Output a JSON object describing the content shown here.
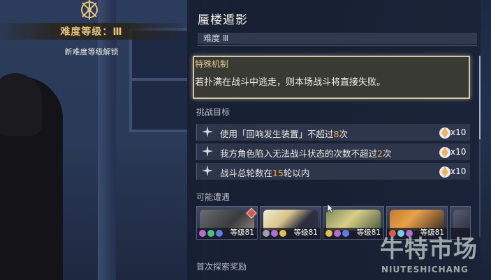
{
  "difficulty": {
    "title": "难度等级：Ⅲ",
    "subtitle": "新难度等级解锁"
  },
  "stage": {
    "title": "蜃楼遁影",
    "difficulty_label": "难度 Ⅲ"
  },
  "special_mechanic": {
    "heading": "特殊机制",
    "text": "若扑满在战斗中逃走，则本场战斗将直接失败。"
  },
  "challenge": {
    "heading": "挑战目标",
    "goals": [
      {
        "before": "使用「回响发生装置」不超过",
        "num": "8",
        "after": "次",
        "reward_qty": "x10"
      },
      {
        "before": "我方角色陷入无法战斗状态的次数不超过",
        "num": "2",
        "after": "次",
        "reward_qty": "x10"
      },
      {
        "before": "战斗总轮数在",
        "num": "15",
        "after": "轮以内",
        "reward_qty": "x10"
      }
    ]
  },
  "encounters": {
    "heading": "可能遭遇",
    "enemies": [
      {
        "level": "等级81"
      },
      {
        "level": "等级81"
      },
      {
        "level": "等级81"
      },
      {
        "level": "等级81"
      }
    ]
  },
  "first_explore": {
    "heading": "首次探索奖励"
  },
  "watermark": {
    "main": "牛特市场",
    "sub": "NIUTESHICHANG"
  },
  "colors": {
    "accent_gold": "#e7c27a",
    "highlight_orange": "#f0a845",
    "special_border": "#cfc9a8"
  }
}
